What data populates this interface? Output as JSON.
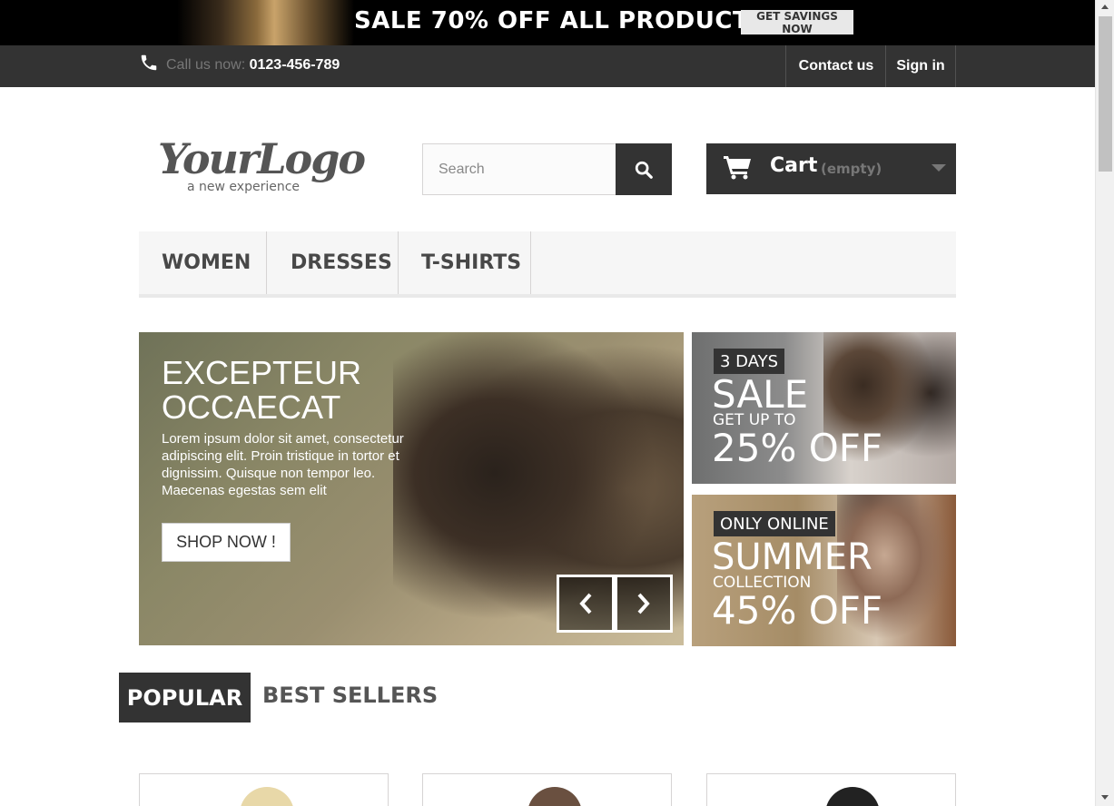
{
  "promo": {
    "text": "SALE 70% OFF ALL PRODUCTS",
    "button": "GET SAVINGS NOW"
  },
  "topbar": {
    "call_label": "Call us now:",
    "phone": "0123-456-789",
    "contact": "Contact us",
    "signin": "Sign in",
    "phone_icon": "phone-icon"
  },
  "header": {
    "logo_main": "YourLogo",
    "logo_sub": "a new experience",
    "search_placeholder": "Search",
    "cart_label": "Cart",
    "cart_status": "(empty)"
  },
  "menu": {
    "items": [
      "WOMEN",
      "DRESSES",
      "T-SHIRTS"
    ]
  },
  "hero": {
    "title_line1": "EXCEPTEUR",
    "title_line2": "OCCAECAT",
    "text": "Lorem ipsum dolor sit amet, consectetur adipiscing elit. Proin tristique in tortor et dignissim. Quisque non tempor leo. Maecenas egestas sem elit",
    "button": "SHOP NOW !"
  },
  "side_banners": [
    {
      "tag": "3 DAYS",
      "big1": "SALE",
      "small": "GET UP TO",
      "big2": "25% OFF"
    },
    {
      "tag": "ONLY ONLINE",
      "big1": "SUMMER",
      "small": "COLLECTION",
      "big2": "45% OFF"
    }
  ],
  "tabs": {
    "popular": "POPULAR",
    "best_sellers": "BEST SELLERS"
  },
  "colors": {
    "dark": "#333333",
    "nav_bg": "#333333",
    "menu_bg": "#f6f6f6"
  }
}
